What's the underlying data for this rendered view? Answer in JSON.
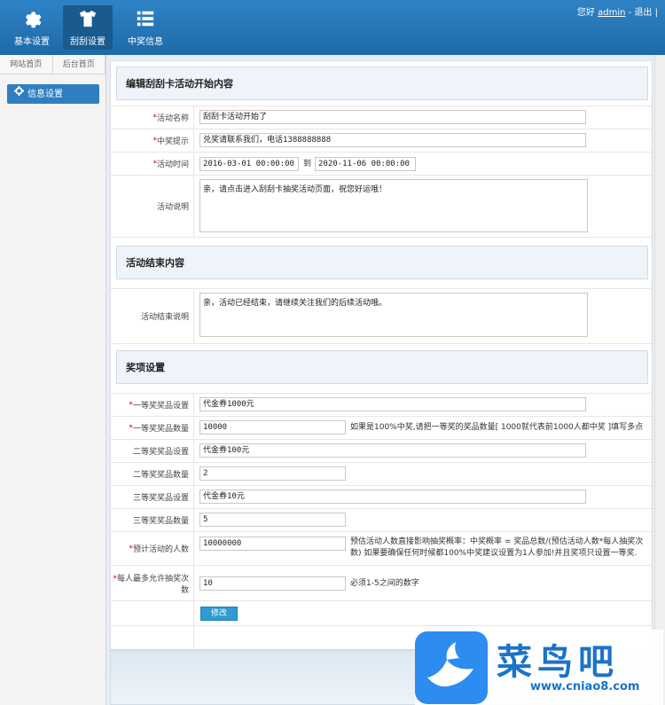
{
  "topnav": [
    {
      "label": "基本设置",
      "icon": "gear-icon"
    },
    {
      "label": "刮刮设置",
      "icon": "shirt-icon"
    },
    {
      "label": "中奖信息",
      "icon": "list-icon"
    }
  ],
  "user": {
    "greeting": "您好",
    "name": "admin",
    "sep1": "-",
    "logout": "退出",
    "sep2": "|"
  },
  "sidebar": {
    "tabs": [
      "网站首页",
      "后台首页"
    ],
    "item": "信息设置"
  },
  "start_section": {
    "title": "编辑刮刮卡活动开始内容",
    "name_label": "活动名称",
    "name_value": "刮刮卡活动开始了",
    "tip_label": "中奖提示",
    "tip_value": "兑奖请联系我们，电话1388888888",
    "time_label": "活动时间",
    "time_start": "2016-03-01 00:00:00",
    "time_to": "到",
    "time_end": "2020-11-06 00:00:00",
    "desc_label": "活动说明",
    "desc_value": "亲，请点击进入刮刮卡抽奖活动页面，祝您好运哦！"
  },
  "end_section": {
    "title": "活动结束内容",
    "desc_label": "活动结束说明",
    "desc_value": "亲，活动已经结束，请继续关注我们的后续活动哦。"
  },
  "prize_section": {
    "title": "奖项设置",
    "first_prize_label": "一等奖奖品设置",
    "first_prize_value": "代金券1000元",
    "first_count_label": "一等奖奖品数量",
    "first_count_value": "10000",
    "first_count_hint": "如果是100%中奖,请把一等奖的奖品数量[ 1000就代表前1000人都中奖 ]填写多点",
    "second_prize_label": "二等奖奖品设置",
    "second_prize_value": "代金券100元",
    "second_count_label": "二等奖奖品数量",
    "second_count_value": "2",
    "third_prize_label": "三等奖奖品设置",
    "third_prize_value": "代金券10元",
    "third_count_label": "三等奖奖品数量",
    "third_count_value": "5",
    "expected_label": "预计活动的人数",
    "expected_value": "10000000",
    "expected_hint": "预估活动人数直接影响抽奖概率：中奖概率 = 奖品总数/(预估活动人数*每人抽奖次数) 如果要确保任何时候都100%中奖建议设置为1人参加!并且奖项只设置一等奖.",
    "max_label": "每人最多允许抽奖次数",
    "max_value": "10",
    "max_hint": "必须1-5之间的数字",
    "submit": "修改"
  },
  "watermark": {
    "brand": "菜鸟吧",
    "url": "www.cniao8.com"
  }
}
